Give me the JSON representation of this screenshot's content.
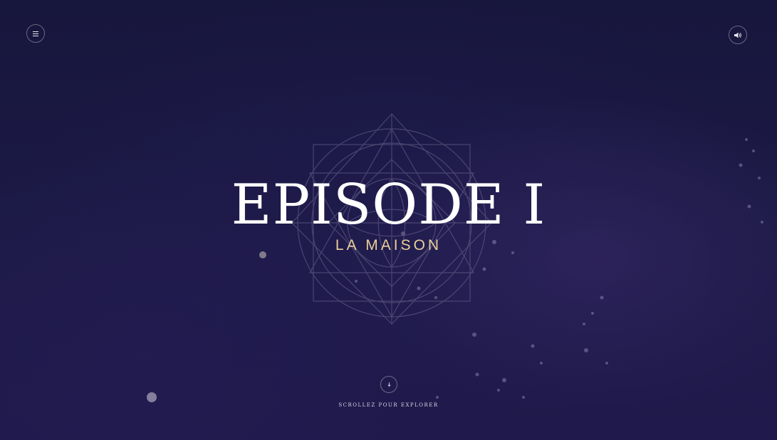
{
  "hero": {
    "title": "EPISODE I",
    "subtitle": "LA MAISON"
  },
  "scroll": {
    "label": "SCROLLEZ POUR EXPLORER"
  },
  "controls": {
    "menu_icon": "hamburger-menu-icon",
    "sound_icon": "speaker-icon",
    "scroll_icon": "arrow-down-icon"
  },
  "colors": {
    "background": "#1b1740",
    "title": "#ffffff",
    "subtitle": "#e9cf97",
    "ornament": "#6d6890"
  }
}
